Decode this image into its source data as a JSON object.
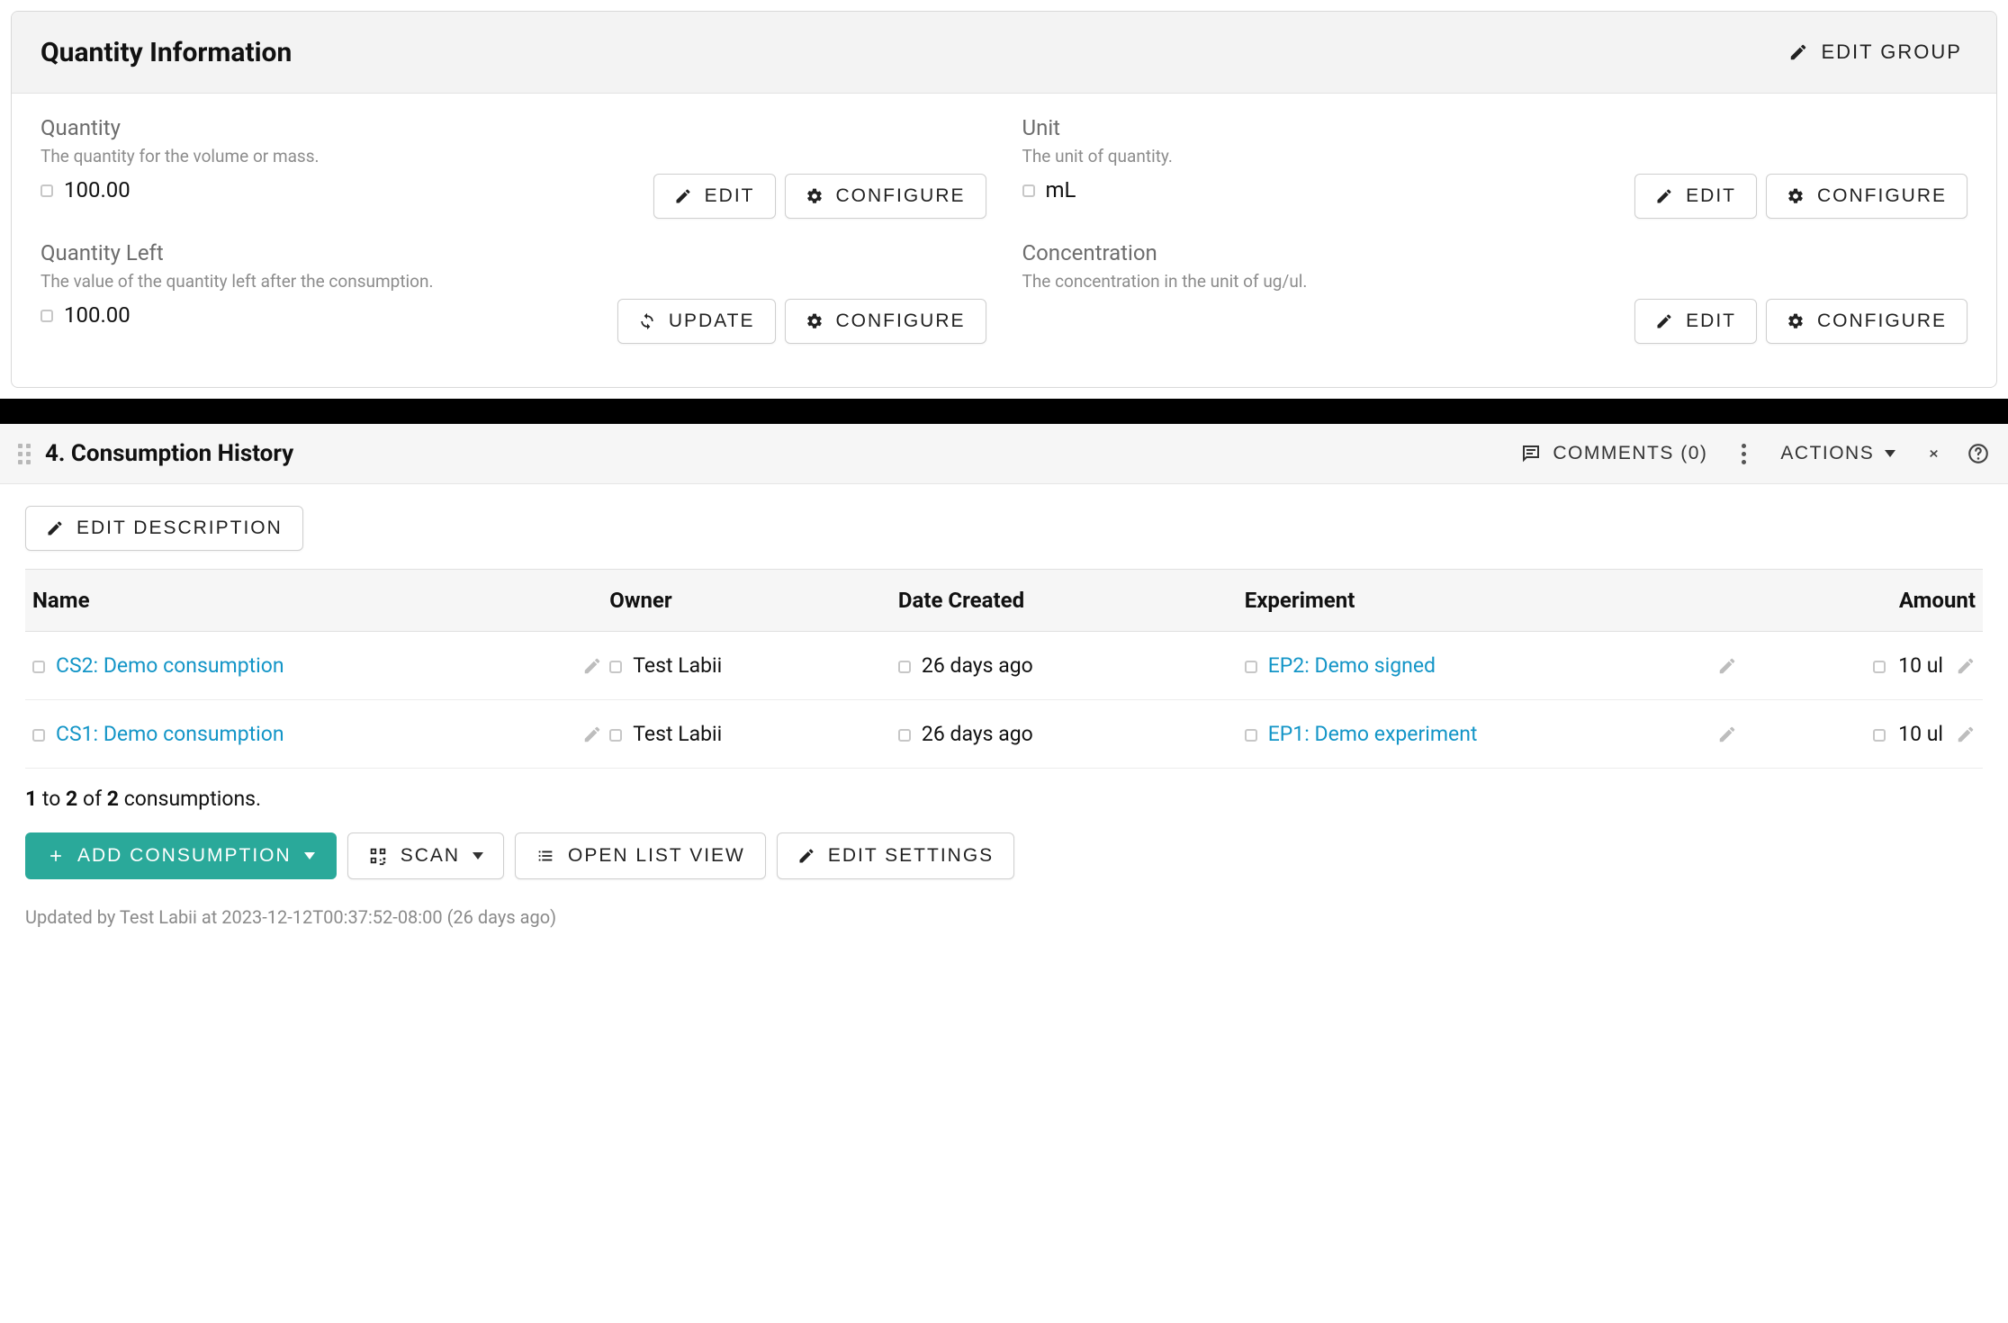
{
  "card": {
    "title": "Quantity Information",
    "editGroup": "EDIT GROUP",
    "btn": {
      "edit": "EDIT",
      "configure": "CONFIGURE",
      "update": "UPDATE"
    },
    "fields": {
      "quantity": {
        "label": "Quantity",
        "help": "The quantity for the volume or mass.",
        "value": "100.00"
      },
      "unit": {
        "label": "Unit",
        "help": "The unit of quantity.",
        "value": "mL"
      },
      "quantityLeft": {
        "label": "Quantity Left",
        "help": "The value of the quantity left after the consumption.",
        "value": "100.00"
      },
      "concentration": {
        "label": "Concentration",
        "help": "The concentration in the unit of ug/ul.",
        "value": ""
      }
    }
  },
  "section": {
    "title": "4. Consumption History",
    "comments": "COMMENTS (0)",
    "actions": "ACTIONS",
    "editDescription": "EDIT DESCRIPTION",
    "columns": {
      "name": "Name",
      "owner": "Owner",
      "date": "Date Created",
      "experiment": "Experiment",
      "amount": "Amount"
    },
    "rows": [
      {
        "name": "CS2: Demo consumption",
        "owner": "Test Labii",
        "date": "26 days ago",
        "experiment": "EP2: Demo signed",
        "amount": "10 ul"
      },
      {
        "name": "CS1: Demo consumption",
        "owner": "Test Labii",
        "date": "26 days ago",
        "experiment": "EP1: Demo experiment",
        "amount": "10 ul"
      }
    ],
    "pager": {
      "from": "1",
      "to": "2",
      "total": "2",
      "suffix": "consumptions."
    },
    "buttons": {
      "add": "ADD CONSUMPTION",
      "scan": "SCAN",
      "openList": "OPEN LIST VIEW",
      "editSettings": "EDIT SETTINGS"
    },
    "footer": "Updated by Test Labii at 2023-12-12T00:37:52-08:00 (26 days ago)"
  }
}
